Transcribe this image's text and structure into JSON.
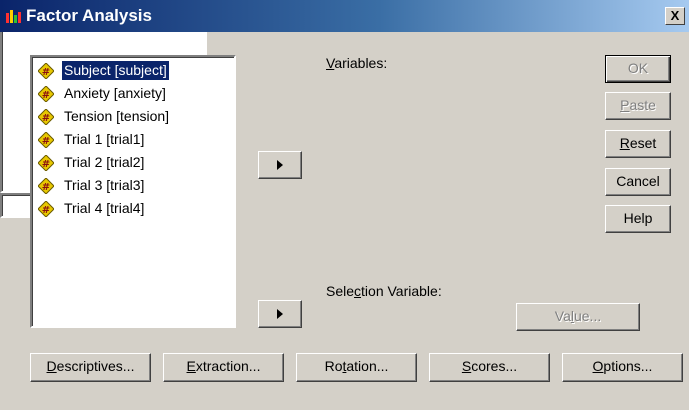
{
  "window": {
    "title": "Factor Analysis",
    "close_glyph": "X"
  },
  "source_list": {
    "items": [
      {
        "label": "Subject [subject]",
        "selected": true
      },
      {
        "label": "Anxiety [anxiety]",
        "selected": false
      },
      {
        "label": "Tension [tension]",
        "selected": false
      },
      {
        "label": "Trial 1 [trial1]",
        "selected": false
      },
      {
        "label": "Trial 2 [trial2]",
        "selected": false
      },
      {
        "label": "Trial 3 [trial3]",
        "selected": false
      },
      {
        "label": "Trial 4 [trial4]",
        "selected": false
      }
    ]
  },
  "variables": {
    "label_mnemonic": "V",
    "label_rest": "ariables:"
  },
  "selection_variable": {
    "label_before": "Sele",
    "label_mnemonic": "c",
    "label_after": "tion Variable:"
  },
  "value_button": {
    "before": "Va",
    "mnemonic": "l",
    "after": "ue..."
  },
  "side_buttons": {
    "ok": "OK",
    "paste": {
      "mnemonic": "P",
      "rest": "aste"
    },
    "reset": {
      "mnemonic": "R",
      "rest": "eset"
    },
    "cancel": "Cancel",
    "help": "Help"
  },
  "bottom_buttons": {
    "descriptives": {
      "mnemonic": "D",
      "rest": "escriptives..."
    },
    "extraction": {
      "mnemonic": "E",
      "rest": "xtraction..."
    },
    "rotation": {
      "before": "Ro",
      "mnemonic": "t",
      "after": "ation..."
    },
    "scores": {
      "mnemonic": "S",
      "rest": "cores..."
    },
    "options": {
      "mnemonic": "O",
      "rest": "ptions..."
    }
  },
  "colors": {
    "titlebar_start": "#0a246a",
    "titlebar_end": "#a6caf0",
    "face": "#d4d0c8",
    "selection": "#0a246a"
  },
  "icons": {
    "variable_icon": "scale-variable-icon",
    "app_icon": "spss-app-icon"
  }
}
